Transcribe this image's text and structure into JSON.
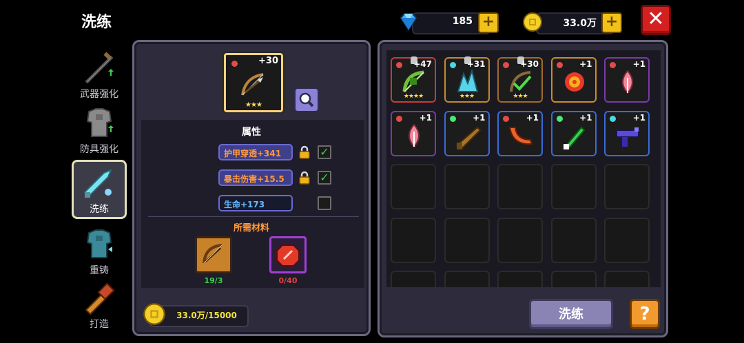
{
  "header": {
    "title": "洗练"
  },
  "currency": {
    "diamonds": "185",
    "gold": "33.0万"
  },
  "nav": [
    {
      "label": "武器强化",
      "icon": "sword-upgrade-icon"
    },
    {
      "label": "防具强化",
      "icon": "armor-upgrade-icon"
    },
    {
      "label": "洗练",
      "icon": "refine-icon",
      "active": true
    },
    {
      "label": "重铸",
      "icon": "recast-icon"
    },
    {
      "label": "打造",
      "icon": "forge-icon"
    }
  ],
  "equipped": {
    "level": "+30",
    "stars": "★★★"
  },
  "attributes": {
    "title": "属性",
    "rows": [
      {
        "text": "护甲穿透+341",
        "locked": true,
        "checked": true
      },
      {
        "text": "暴击伤害+15.5",
        "locked": true,
        "checked": true
      },
      {
        "text": "生命+173",
        "locked": false,
        "checked": false
      }
    ]
  },
  "materials": {
    "title": "所需材料",
    "items": [
      {
        "count": "19/3",
        "icon": "crossbow-material-icon"
      },
      {
        "count": "0/40",
        "icon": "red-stone-material-icon"
      }
    ]
  },
  "cost": {
    "text": "33.0万/15000"
  },
  "inventory": {
    "items": [
      {
        "level": "+47",
        "stars": "★★★★",
        "gem": "#e64a4a",
        "icon": "green-crossbow-icon",
        "border": "#c73b3b",
        "locked": true
      },
      {
        "level": "+31",
        "stars": "★★★",
        "gem": "#4ad7e6",
        "icon": "ice-crystal-icon",
        "border": "#c48a2c",
        "locked": true
      },
      {
        "level": "+30",
        "stars": "★★★",
        "gem": "#e64a4a",
        "icon": "bow-icon",
        "border": "#a06a2a",
        "locked": true
      },
      {
        "level": "+1",
        "stars": "",
        "gem": "#e64a4a",
        "icon": "red-flower-icon",
        "border": "#d08a2a",
        "locked": false
      },
      {
        "level": "+1",
        "stars": "",
        "gem": "#e64a4a",
        "icon": "pink-leaf-icon",
        "border": "#7a3aa8",
        "locked": false
      },
      {
        "level": "+1",
        "stars": "",
        "gem": "#e64a4a",
        "icon": "pink-leaf-icon",
        "border": "#7a3aa8",
        "locked": false
      },
      {
        "level": "+1",
        "stars": "",
        "gem": "#4ae67a",
        "icon": "shotgun-icon",
        "border": "#3a6ad6",
        "locked": false
      },
      {
        "level": "+1",
        "stars": "",
        "gem": "#e64a4a",
        "icon": "boomerang-icon",
        "border": "#3a6ad6",
        "locked": false
      },
      {
        "level": "+1",
        "stars": "",
        "gem": "#4ae67a",
        "icon": "green-dagger-icon",
        "border": "#3a6ad6",
        "locked": false
      },
      {
        "level": "+1",
        "stars": "",
        "gem": "#4ad7e6",
        "icon": "purple-gun-icon",
        "border": "#3a6ad6",
        "locked": false
      }
    ],
    "empty_slots": 15
  },
  "actions": {
    "refine": "洗练",
    "help": "?"
  },
  "colors": {
    "accent_gold": "#f2c21a",
    "close_red": "#d32020",
    "panel": "#2e2c3c"
  }
}
